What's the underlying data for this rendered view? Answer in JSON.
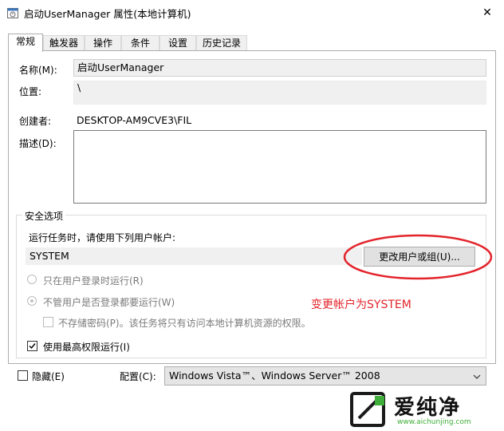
{
  "window": {
    "title": "启动UserManager 属性(本地计算机)",
    "close_glyph": "✕"
  },
  "tabs": [
    {
      "label": "常规",
      "active": true
    },
    {
      "label": "触发器",
      "active": false
    },
    {
      "label": "操作",
      "active": false
    },
    {
      "label": "条件",
      "active": false
    },
    {
      "label": "设置",
      "active": false
    },
    {
      "label": "历史记录",
      "active": false
    }
  ],
  "general": {
    "name_label": "名称(M):",
    "name_value": "启动UserManager",
    "location_label": "位置:",
    "location_value": "\\",
    "author_label": "创建者:",
    "author_value": "DESKTOP-AM9CVE3\\FIL",
    "description_label": "描述(D):",
    "description_value": ""
  },
  "security": {
    "group_title": "安全选项",
    "run_as_label": "运行任务时，请使用下列用户帐户:",
    "user_account": "SYSTEM",
    "change_user_button": "更改用户或组(U)...",
    "radio_logged_on": "只在用户登录时运行(R)",
    "radio_whether_logged_on": "不管用户是否登录都要运行(W)",
    "do_not_store_password": "不存储密码(P)。该任务将只有访问本地计算机资源的权限。",
    "highest_privileges": "使用最高权限运行(I)",
    "highest_privileges_checked": true
  },
  "footer": {
    "hidden_label": "隐藏(E)",
    "hidden_checked": false,
    "configure_label": "配置(C):",
    "configure_value": "Windows Vista™、Windows Server™ 2008"
  },
  "annotation": {
    "text": "变更帐户为SYSTEM",
    "color": "#e3242b"
  },
  "watermark": {
    "brand": "爱纯净",
    "url": "www.aichunjing.com"
  }
}
